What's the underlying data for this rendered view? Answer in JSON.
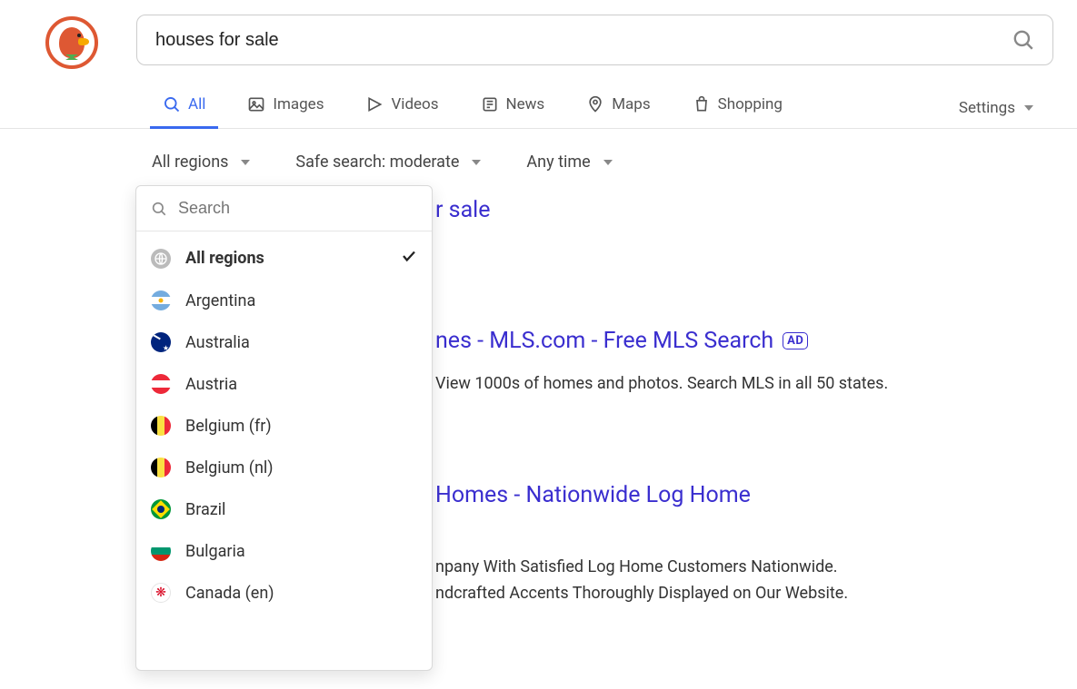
{
  "search": {
    "query": "houses for sale",
    "placeholder": ""
  },
  "tabs": {
    "all": "All",
    "images": "Images",
    "videos": "Videos",
    "news": "News",
    "maps": "Maps",
    "shopping": "Shopping",
    "settings": "Settings"
  },
  "filters": {
    "region": "All regions",
    "safesearch": "Safe search: moderate",
    "time": "Any time"
  },
  "dropdown": {
    "searchPlaceholder": "Search",
    "items": [
      {
        "label": "All regions",
        "flag": "globe",
        "selected": true
      },
      {
        "label": "Argentina",
        "flag": "ar"
      },
      {
        "label": "Australia",
        "flag": "au"
      },
      {
        "label": "Austria",
        "flag": "at"
      },
      {
        "label": "Belgium (fr)",
        "flag": "be"
      },
      {
        "label": "Belgium (nl)",
        "flag": "be"
      },
      {
        "label": "Brazil",
        "flag": "br"
      },
      {
        "label": "Bulgaria",
        "flag": "bg"
      },
      {
        "label": "Canada (en)",
        "flag": "ca"
      }
    ]
  },
  "results": [
    {
      "titlePrefix": "r sale",
      "desc1": "",
      "ad": false
    },
    {
      "title": "nes - MLS.com - Free MLS Search",
      "desc1": "View 1000s of homes and photos. Search MLS in all 50 states.",
      "ad": true
    },
    {
      "title": "Homes - Nationwide Log Home",
      "desc1": "npany With Satisfied Log Home Customers Nationwide.",
      "desc2": "ndcrafted Accents Thoroughly Displayed on Our Website.",
      "ad": false
    }
  ]
}
